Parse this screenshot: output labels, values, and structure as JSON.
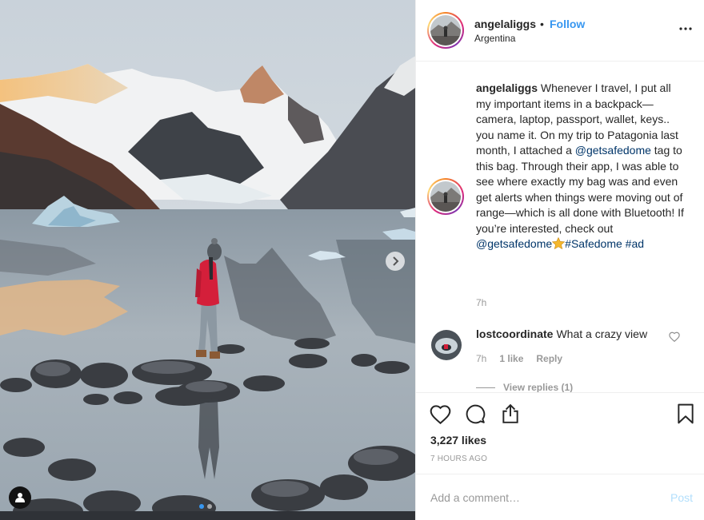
{
  "post": {
    "username": "angelaliggs",
    "separator": "•",
    "follow_label": "Follow",
    "location": "Argentina",
    "caption": {
      "username": "angelaliggs",
      "text_part1": "Whenever I travel, I put all my important items in a backpack—camera, laptop, passport, wallet, keys.. you name it. On my trip to Patagonia last month, I attached a",
      "mention1": "@getsafedome",
      "text_part2": "tag to this bag. Through their app, I was able to see where exactly my bag was and even get alerts when things were moving out of range—which is all done with Bluetooth! If you’re interested, check out",
      "mention2": "@getsafedome",
      "hashtag1": "#Safedome",
      "hashtag2": "#ad",
      "time": "7h"
    },
    "comments": [
      {
        "username": "lostcoordinate",
        "text": "What a crazy view",
        "time": "7h",
        "likes": "1 like",
        "reply_label": "Reply",
        "view_replies": "View replies (1)"
      }
    ],
    "likes": "3,227 likes",
    "time_ago": "7 HOURS AGO",
    "comment_input_placeholder": "Add a comment…",
    "post_button": "Post"
  },
  "carousel": {
    "current": 1,
    "total": 2
  },
  "icons": {
    "more": "more-options-icon",
    "next": "chevron-right-icon",
    "tag": "user-tag-icon",
    "like": "heart-icon",
    "comment": "comment-icon",
    "share": "share-icon",
    "save": "bookmark-icon",
    "comment_like": "heart-icon",
    "mention_emoji": "star-icon"
  },
  "colors": {
    "link": "#003569",
    "follow": "#3897f0",
    "muted": "#999999",
    "post_disabled": "#b2dffc",
    "jacket": "#d41f3a"
  }
}
